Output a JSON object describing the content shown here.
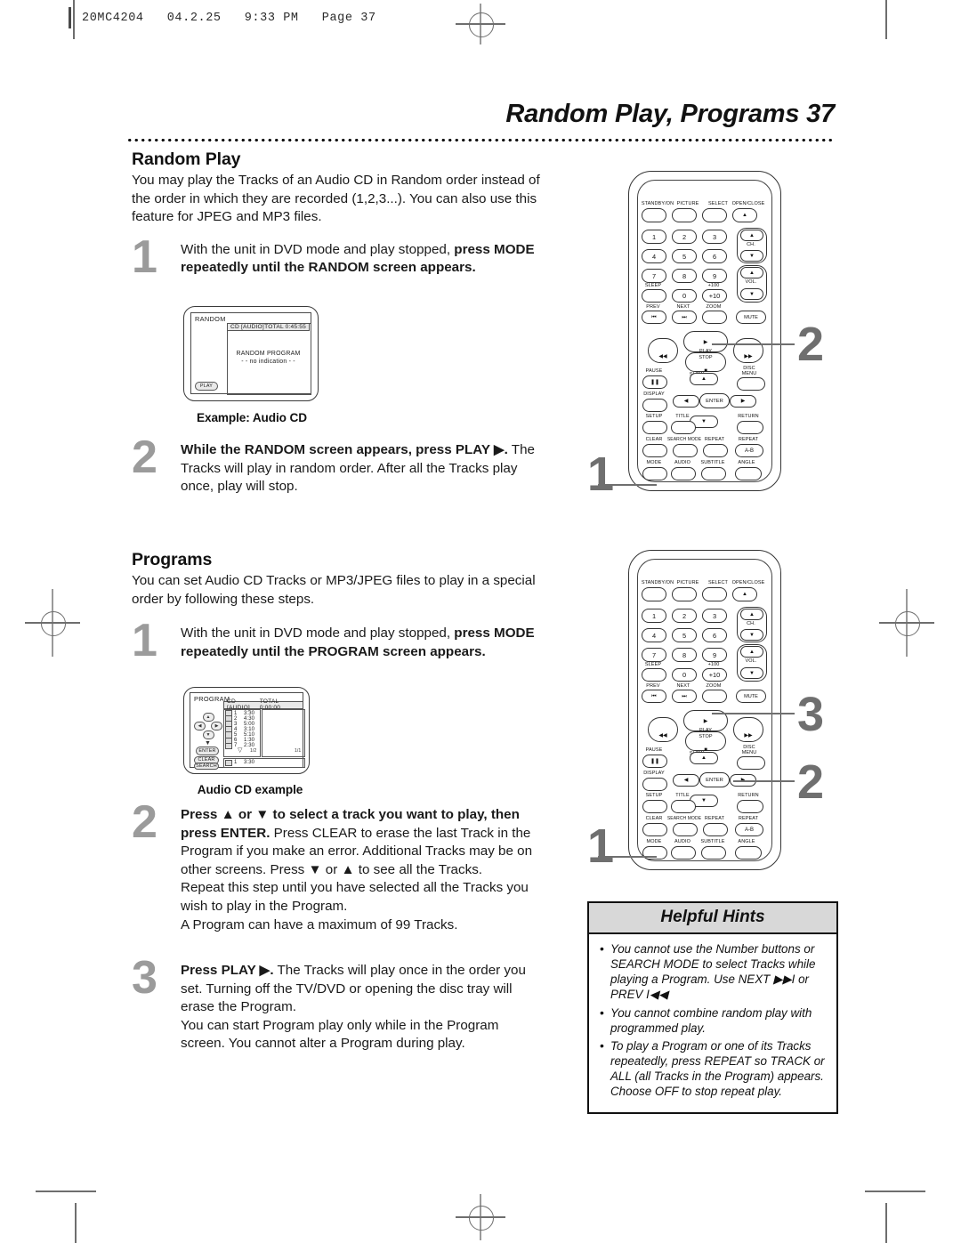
{
  "slug": {
    "text": "20MC4204   04.2.25   9:33 PM   Page 37"
  },
  "header": {
    "title": "Random Play, Programs  37"
  },
  "random": {
    "heading": "Random Play",
    "intro": "You may play the Tracks of an Audio CD in Random order instead of the order in which they are recorded (1,2,3...). You can also use this feature for JPEG and MP3 files.",
    "steps": [
      {
        "num": "1",
        "html": "With the unit in DVD mode and play stopped, <b>press MODE repeatedly until the RANDOM screen appears.</b>"
      },
      {
        "num": "2",
        "html": "<b>While the RANDOM screen appears, press PLAY ▶.</b> The Tracks will play in random order. After all the Tracks play once, play will stop."
      }
    ],
    "screen": {
      "title": "RANDOM",
      "disc": "CD [AUDIO]",
      "total": "TOTAL  0:45:55",
      "line1": "RANDOM PROGRAM",
      "line2": "- -  no indication  - -",
      "play_badge": "PLAY",
      "caption": "Example: Audio CD"
    }
  },
  "programs": {
    "heading": "Programs",
    "intro": "You can set Audio CD Tracks or MP3/JPEG files to play in a special order by following these steps.",
    "steps": [
      {
        "num": "1",
        "html": "With the unit in DVD mode and play stopped, <b>press MODE repeatedly until the PROGRAM screen appears.</b>"
      },
      {
        "num": "2",
        "html": "<b>Press ▲ or ▼ to select a track you want to play, then press ENTER.</b> Press CLEAR to erase the last Track in the Program if you make an error. Additional Tracks may be on other screens. Press ▼ or ▲ to see all the Tracks.<br>Repeat this step until you have selected all the Tracks you wish to play in the Program.<br>A Program can have a maximum of 99 Tracks."
      },
      {
        "num": "3",
        "html": "<b>Press PLAY ▶.</b> The Tracks will play once in the order you set. Turning off the TV/DVD or opening the disc tray will erase the Program.<br>You can start Program play only while in the Program screen. You cannot alter a Program during play."
      }
    ],
    "screen": {
      "title": "PROGRAM",
      "disc": "CD [AUDIO]",
      "total": "TOTAL  0:00:00",
      "tracks": [
        {
          "no": "1",
          "time": "3:30"
        },
        {
          "no": "2",
          "time": "4:30"
        },
        {
          "no": "3",
          "time": "5:00"
        },
        {
          "no": "4",
          "time": "3:10"
        },
        {
          "no": "5",
          "time": "5:10"
        },
        {
          "no": "6",
          "time": "1:30"
        },
        {
          "no": "7",
          "time": "2:30"
        }
      ],
      "page_left": "1/2",
      "page_right": "1/1",
      "selected_no": "1",
      "selected_time": "3:30",
      "side_buttons": [
        "CLEAR",
        "SEARCH",
        "MODE"
      ],
      "enter_label": "ENTER",
      "caption": "Audio CD example"
    }
  },
  "remote": {
    "row_top": [
      "STANDBY/ON",
      "PICTURE",
      "SELECT",
      "OPEN/CLOSE"
    ],
    "numbers": [
      "1",
      "2",
      "3",
      "4",
      "5",
      "6",
      "7",
      "8",
      "9",
      "0"
    ],
    "ch_label": "CH.",
    "vol_label": "VOL.",
    "sleep": "SLEEP",
    "plus100": "+100",
    "plus10": "+10",
    "prev": "PREV",
    "next": "NEXT",
    "zoom": "ZOOM",
    "mute": "MUTE",
    "play": "PLAY",
    "stop": "STOP",
    "slow": "SLOW",
    "pause": "PAUSE",
    "disc_menu": "DISC MENU",
    "display": "DISPLAY",
    "enter": "ENTER",
    "setup": "SETUP",
    "title": "TITLE",
    "return": "RETURN",
    "clear": "CLEAR",
    "search_mode": "SEARCH MODE",
    "repeat": "REPEAT",
    "repeat_ab_label": "REPEAT",
    "repeat_ab": "A-B",
    "mode": "MODE",
    "audio": "AUDIO",
    "subtitle": "SUBTITLE",
    "angle": "ANGLE",
    "callouts_top": [
      "2",
      "1"
    ],
    "callouts_bottom": [
      "3",
      "2",
      "1"
    ]
  },
  "hints": {
    "title": "Helpful Hints",
    "items": [
      "You cannot use the Number buttons or SEARCH MODE to select Tracks while playing a Program. Use NEXT ▶▶I or PREV I◀◀",
      "You cannot combine random play with programmed play.",
      "To play a Program or one of its Tracks repeatedly, press REPEAT so TRACK or ALL (all Tracks in the Program) appears. Choose OFF to stop repeat play."
    ]
  }
}
